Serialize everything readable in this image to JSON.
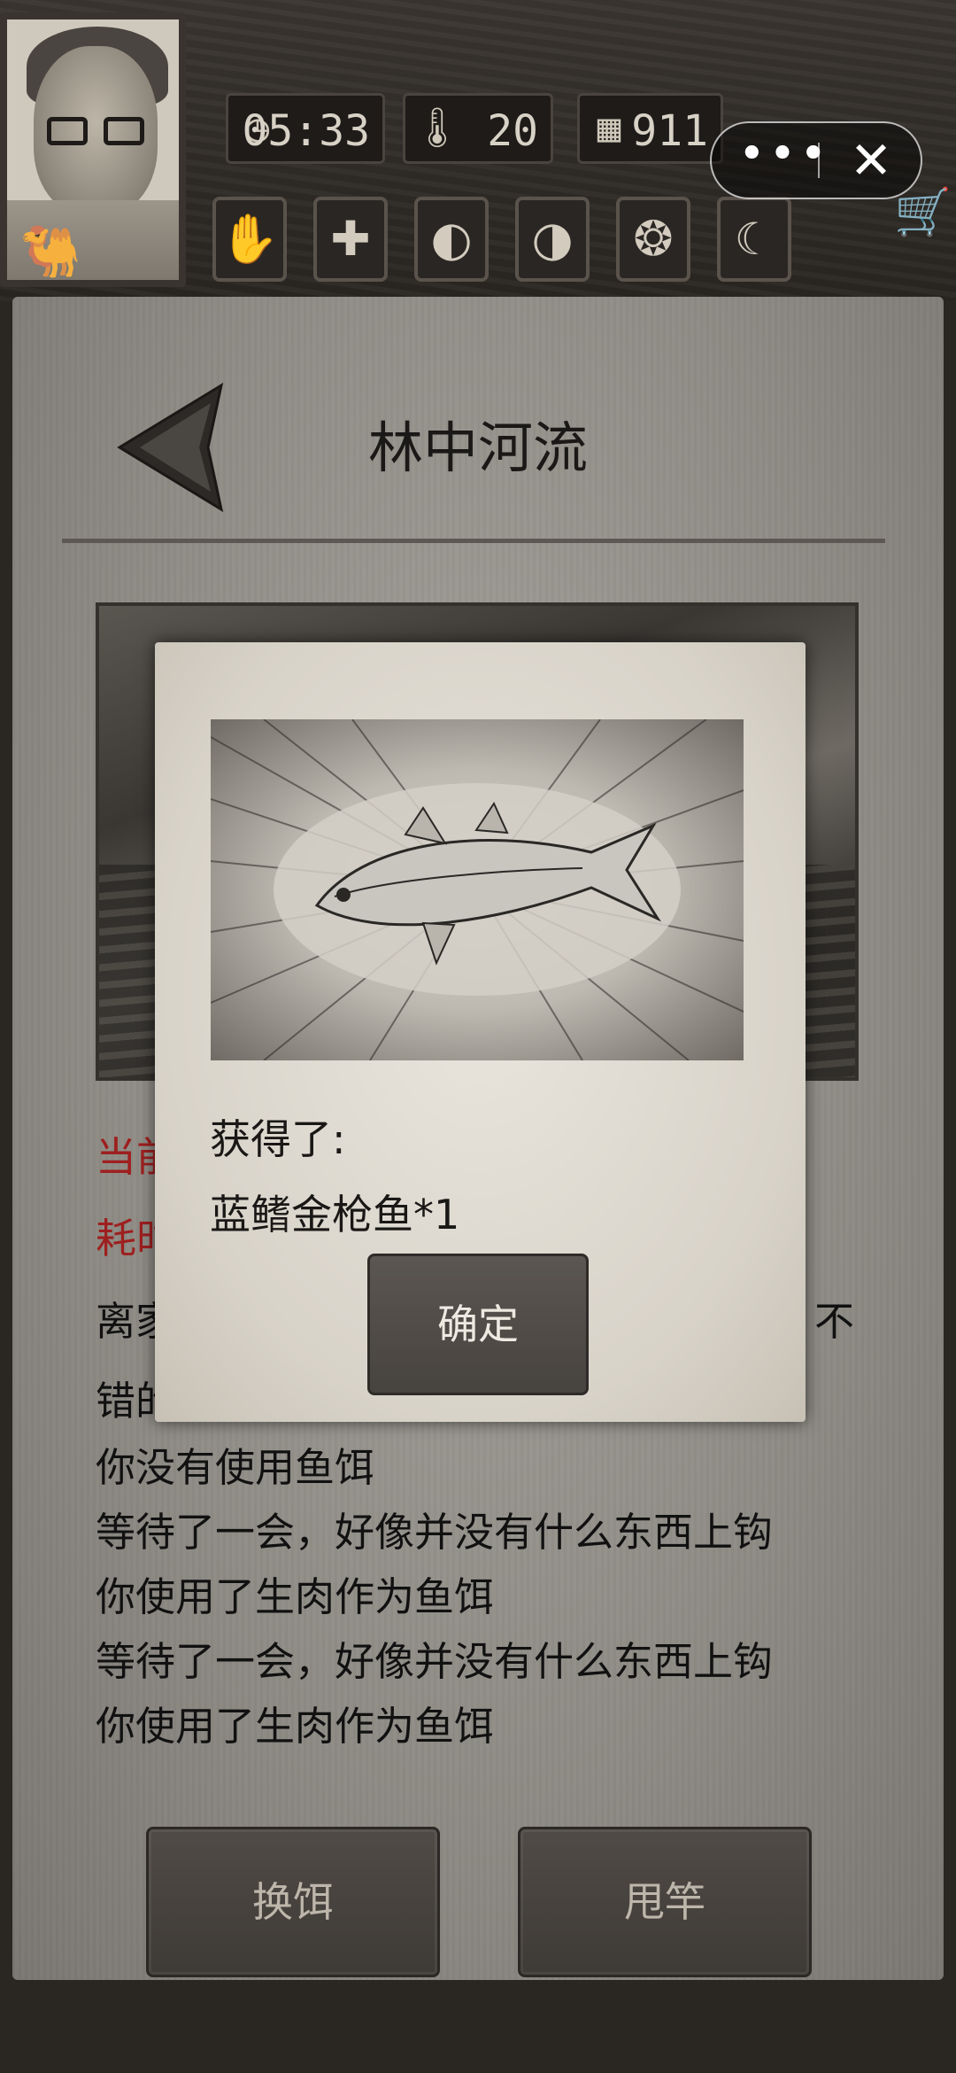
{
  "status": {
    "time": "05:33",
    "temperature": "20",
    "day": "911"
  },
  "icons": {
    "clock": "clock-icon",
    "thermometer": "thermometer-icon",
    "calendar": "calendar-icon"
  },
  "header": {
    "title": "林中河流"
  },
  "info": {
    "current_label": "当前",
    "time_label": "耗时",
    "line1_left": "离家",
    "line1_right": "不",
    "line2_left": "错的"
  },
  "log": [
    "你没有使用鱼饵",
    "等待了一会，好像并没有什么东西上钩",
    "你使用了生肉作为鱼饵",
    "等待了一会，好像并没有什么东西上钩",
    "你使用了生肉作为鱼饵"
  ],
  "actions": {
    "change_bait": "换饵",
    "cast_rod": "甩竿"
  },
  "dialog": {
    "got_label": "获得了:",
    "item": "蓝鳍金枪鱼*1",
    "confirm": "确定"
  },
  "colors": {
    "accent_red": "#9e1f1f",
    "paper": "#a4a19b",
    "button": "#4b4641"
  }
}
